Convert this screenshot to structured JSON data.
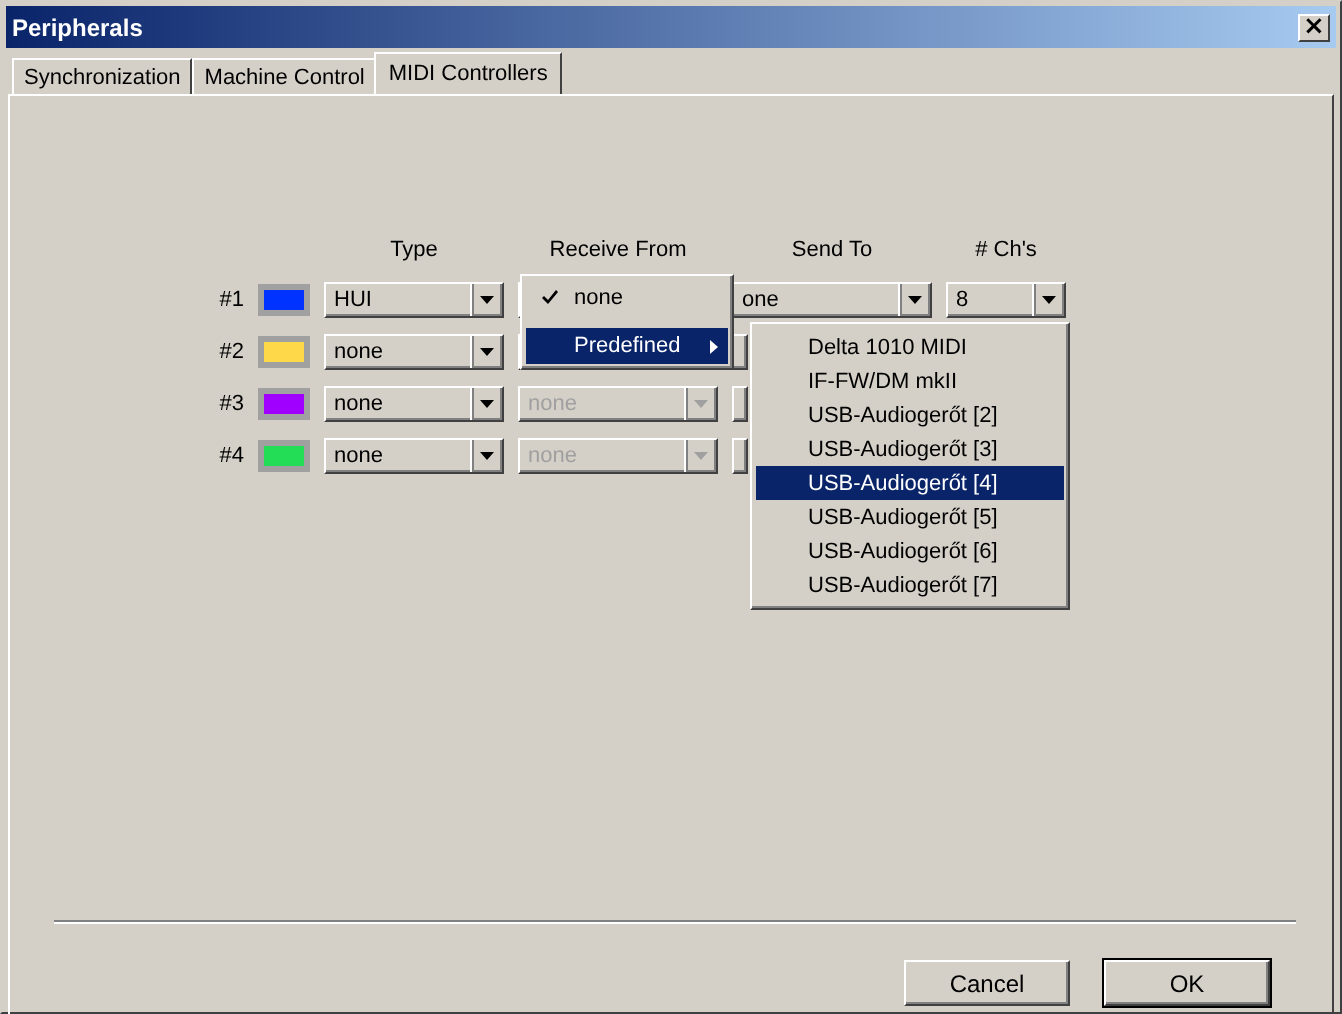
{
  "window": {
    "title": "Peripherals",
    "close": "×"
  },
  "tabs": [
    {
      "label": "Synchronization",
      "selected": false
    },
    {
      "label": "Machine Control",
      "selected": false
    },
    {
      "label": "MIDI Controllers",
      "selected": true
    }
  ],
  "columns": [
    "Type",
    "Receive From",
    "Send To",
    "# Ch's"
  ],
  "controllers": [
    {
      "label": "#1",
      "color": "#0033ff",
      "type": "HUI",
      "send_to": "one",
      "channels": "8"
    },
    {
      "label": "#2",
      "color": "#ffd84a",
      "type": "none"
    },
    {
      "label": "#3",
      "color": "#a000ff",
      "type": "none",
      "receive_from": "none",
      "receive_disabled": true
    },
    {
      "label": "#4",
      "color": "#22dd55",
      "type": "none",
      "receive_from": "none",
      "receive_disabled": true
    }
  ],
  "context_menu": {
    "items": [
      {
        "label": "none",
        "checked": true,
        "selected": false,
        "kind": "item"
      },
      {
        "label": "Predefined",
        "checked": false,
        "selected": true,
        "kind": "submenu"
      }
    ]
  },
  "submenu": {
    "items": [
      {
        "label": "Delta 1010 MIDI",
        "selected": false
      },
      {
        "label": "IF-FW/DM mkII",
        "selected": false
      },
      {
        "label": "USB-Audiogerőt [2]",
        "selected": false
      },
      {
        "label": "USB-Audiogerőt [3]",
        "selected": false
      },
      {
        "label": "USB-Audiogerőt [4]",
        "selected": true
      },
      {
        "label": "USB-Audiogerőt [5]",
        "selected": false
      },
      {
        "label": "USB-Audiogerőt [6]",
        "selected": false
      },
      {
        "label": "USB-Audiogerőt [7]",
        "selected": false
      }
    ]
  },
  "buttons": [
    {
      "label": "Cancel",
      "default": false
    },
    {
      "label": "OK",
      "default": true
    }
  ]
}
